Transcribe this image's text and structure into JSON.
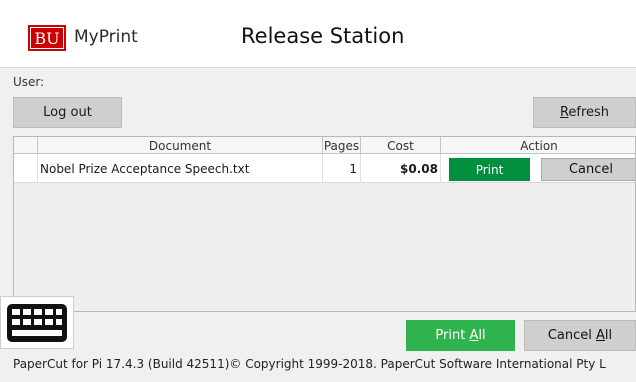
{
  "header": {
    "logo_text": "BU",
    "brand": "MyPrint",
    "title": "Release Station"
  },
  "user": {
    "label": "User:"
  },
  "buttons": {
    "logout": "Log out",
    "refresh_mnemonic": "R",
    "refresh_rest": "efresh",
    "print_all_prefix": "Print ",
    "print_all_mnemonic": "A",
    "print_all_suffix": "ll",
    "cancel_all_prefix": "Cancel ",
    "cancel_all_mnemonic": "A",
    "cancel_all_suffix": "ll"
  },
  "table": {
    "columns": [
      "",
      "Document",
      "Pages",
      "Cost",
      "Action"
    ],
    "rows": [
      {
        "document": "Nobel Prize Acceptance Speech.txt",
        "pages": "1",
        "cost": "$0.08",
        "print_label": "Print",
        "cancel_label": "Cancel"
      }
    ]
  },
  "footer": {
    "text": "PaperCut for Pi  17.4.3 (Build 42511)© Copyright 1999-2018. PaperCut Software International Pty L"
  },
  "icons": {
    "keyboard": "keyboard-icon"
  },
  "colors": {
    "bu_red": "#cc0000",
    "print_green": "#008f3e",
    "print_all_green": "#2fb34d",
    "gray_button": "#cfcfcf"
  }
}
